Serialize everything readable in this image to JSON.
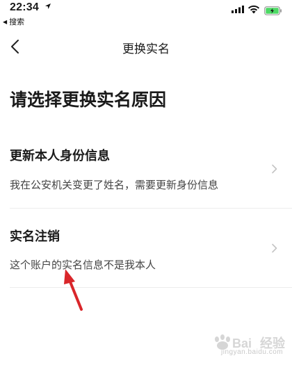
{
  "status_bar": {
    "time": "22:34",
    "back_app": "搜索"
  },
  "nav": {
    "title": "更换实名"
  },
  "page": {
    "heading": "请选择更换实名原因"
  },
  "options": [
    {
      "title": "更新本人身份信息",
      "description": "我在公安机关变更了姓名，需要更新身份信息"
    },
    {
      "title": "实名注销",
      "description": "这个账户的实名信息不是我本人"
    }
  ],
  "watermark": {
    "text": "jingyan.baidu.com"
  },
  "colors": {
    "annotation": "#d9262a",
    "battery": "#4cd964",
    "divider": "#ececec",
    "chevron": "#c4c4c4"
  }
}
